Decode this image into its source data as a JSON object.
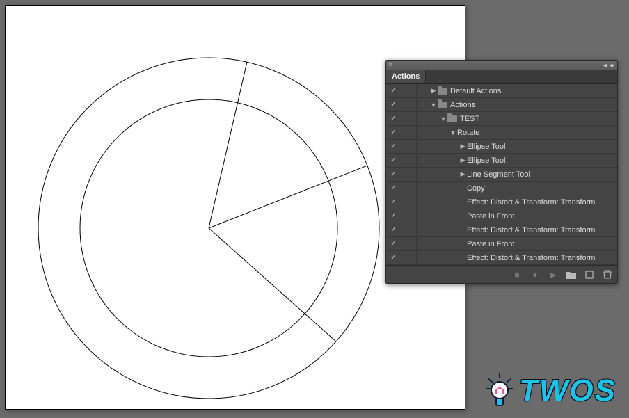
{
  "panel": {
    "title": "Actions",
    "items": [
      {
        "label": "Default Actions",
        "indent": 1,
        "check": true,
        "disclose": "▶",
        "folder": true
      },
      {
        "label": "Actions",
        "indent": 1,
        "check": true,
        "disclose": "▼",
        "folder": true
      },
      {
        "label": "TEST",
        "indent": 2,
        "check": true,
        "disclose": "▼",
        "folder": true
      },
      {
        "label": "Rotate",
        "indent": 3,
        "check": true,
        "disclose": "▼",
        "folder": false
      },
      {
        "label": "Ellipse Tool",
        "indent": 4,
        "check": true,
        "disclose": "▶",
        "folder": false
      },
      {
        "label": "Ellipse Tool",
        "indent": 4,
        "check": true,
        "disclose": "▶",
        "folder": false
      },
      {
        "label": "Line Segment Tool",
        "indent": 4,
        "check": true,
        "disclose": "▶",
        "folder": false
      },
      {
        "label": "Copy",
        "indent": 4,
        "check": true,
        "disclose": "",
        "folder": false
      },
      {
        "label": "Effect: Distort & Transform: Transform",
        "indent": 4,
        "check": true,
        "disclose": "",
        "folder": false
      },
      {
        "label": "Paste in Front",
        "indent": 4,
        "check": true,
        "disclose": "",
        "folder": false
      },
      {
        "label": "Effect: Distort & Transform: Transform",
        "indent": 4,
        "check": true,
        "disclose": "",
        "folder": false
      },
      {
        "label": "Paste in Front",
        "indent": 4,
        "check": true,
        "disclose": "",
        "folder": false
      },
      {
        "label": "Effect: Distort & Transform: Transform",
        "indent": 4,
        "check": true,
        "disclose": "",
        "folder": false
      }
    ]
  },
  "watermark": {
    "text": "TWOS"
  }
}
